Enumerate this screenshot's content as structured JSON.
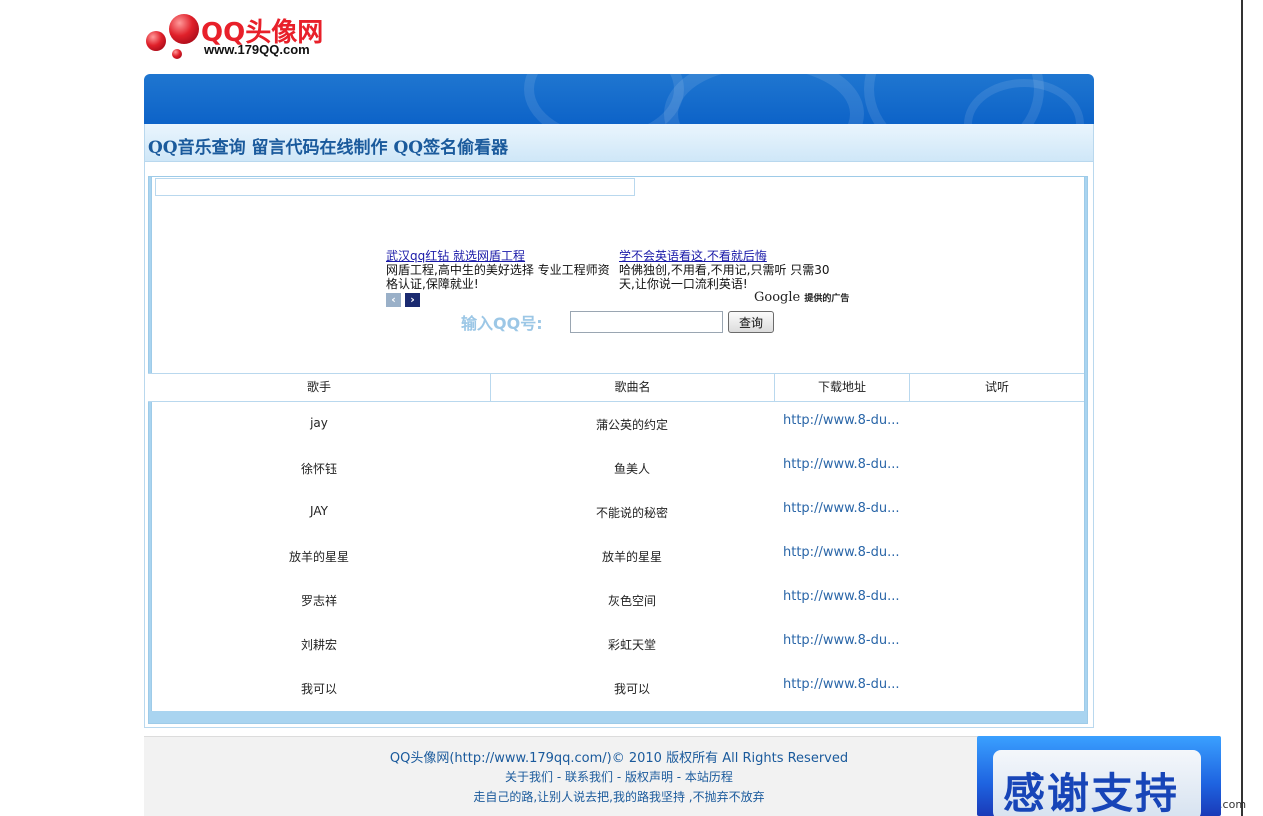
{
  "logo": {
    "title": "QQ头像网",
    "url": "www.179QQ.com"
  },
  "nav": {
    "links": "QQ音乐查询 留言代码在线制作 QQ签名偷看器"
  },
  "ads": [
    {
      "link": "武汉qq红钻 就选网盾工程",
      "desc": "网盾工程,高中生的美好选择 专业工程师资格认证,保障就业!"
    },
    {
      "link": "学不会英语看这,不看就后悔",
      "desc": "哈佛独创,不用看,不用记,只需听 只需30天,让你说一口流利英语!"
    }
  ],
  "ad_nav": {
    "prev": "‹",
    "next": "›"
  },
  "google": {
    "brand": "Google",
    "suffix": "提供的广告"
  },
  "query": {
    "label": "输入QQ号:",
    "input_value": "",
    "button": "查询"
  },
  "table": {
    "headers": [
      "歌手",
      "歌曲名",
      "下载地址",
      "试听"
    ],
    "rows": [
      {
        "singer": "jay",
        "song": "蒲公英的约定",
        "download": "http://www.8-du..."
      },
      {
        "singer": "徐怀钰",
        "song": "鱼美人",
        "download": "http://www.8-du..."
      },
      {
        "singer": "JAY",
        "song": "不能说的秘密",
        "download": "http://www.8-du..."
      },
      {
        "singer": "放羊的星星",
        "song": "放羊的星星",
        "download": "http://www.8-du..."
      },
      {
        "singer": "罗志祥",
        "song": "灰色空间",
        "download": "http://www.8-du..."
      },
      {
        "singer": "刘耕宏",
        "song": "彩虹天堂",
        "download": "http://www.8-du..."
      },
      {
        "singer": "我可以",
        "song": "我可以",
        "download": "http://www.8-du..."
      }
    ]
  },
  "footer": {
    "copyright": "QQ头像网(http://www.179qq.com/)© 2010 版权所有 All Rights Reserved",
    "links": "关于我们 - 联系我们 - 版权声明 - 本站历程",
    "motto": "走自己的路,让别人说去把,我的路我坚持 ,不抛弃不放弃"
  },
  "thanks": {
    "text": "感谢支持"
  },
  "edge_text": "i.com",
  "colors": {
    "banner": "#0d63c8",
    "nav_text": "#1a5a9c",
    "link": "#2a66a8",
    "logo_red": "#e8202a"
  }
}
